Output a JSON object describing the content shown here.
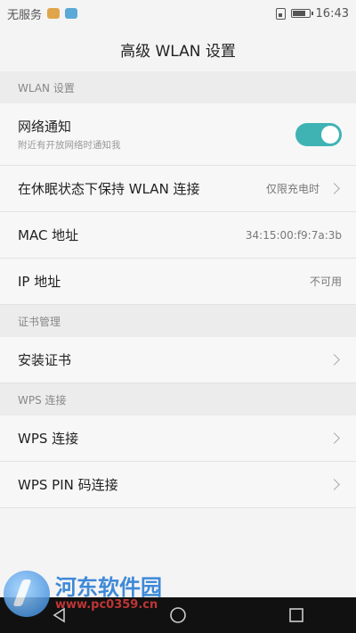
{
  "status_bar": {
    "carrier": "无服务",
    "time": "16:43"
  },
  "title": "高级 WLAN 设置",
  "sections": [
    {
      "header": "WLAN 设置",
      "rows": [
        {
          "title": "网络通知",
          "subtitle": "附近有开放网络时通知我",
          "control": "toggle",
          "toggle_on": true
        },
        {
          "title": "在休眠状态下保持 WLAN 连接",
          "value": "仅限充电时",
          "control": "chevron"
        },
        {
          "title": "MAC 地址",
          "value": "34:15:00:f9:7a:3b"
        },
        {
          "title": "IP 地址",
          "value": "不可用"
        }
      ]
    },
    {
      "header": "证书管理",
      "rows": [
        {
          "title": "安装证书",
          "control": "chevron"
        }
      ]
    },
    {
      "header": "WPS 连接",
      "rows": [
        {
          "title": "WPS 连接",
          "control": "chevron"
        },
        {
          "title": "WPS PIN 码连接",
          "control": "chevron"
        }
      ]
    }
  ],
  "watermark": {
    "title": "河东软件园",
    "url": "www.pc0359.cn"
  },
  "colors": {
    "accent": "#3fb3b4",
    "navbar": "#111111"
  }
}
